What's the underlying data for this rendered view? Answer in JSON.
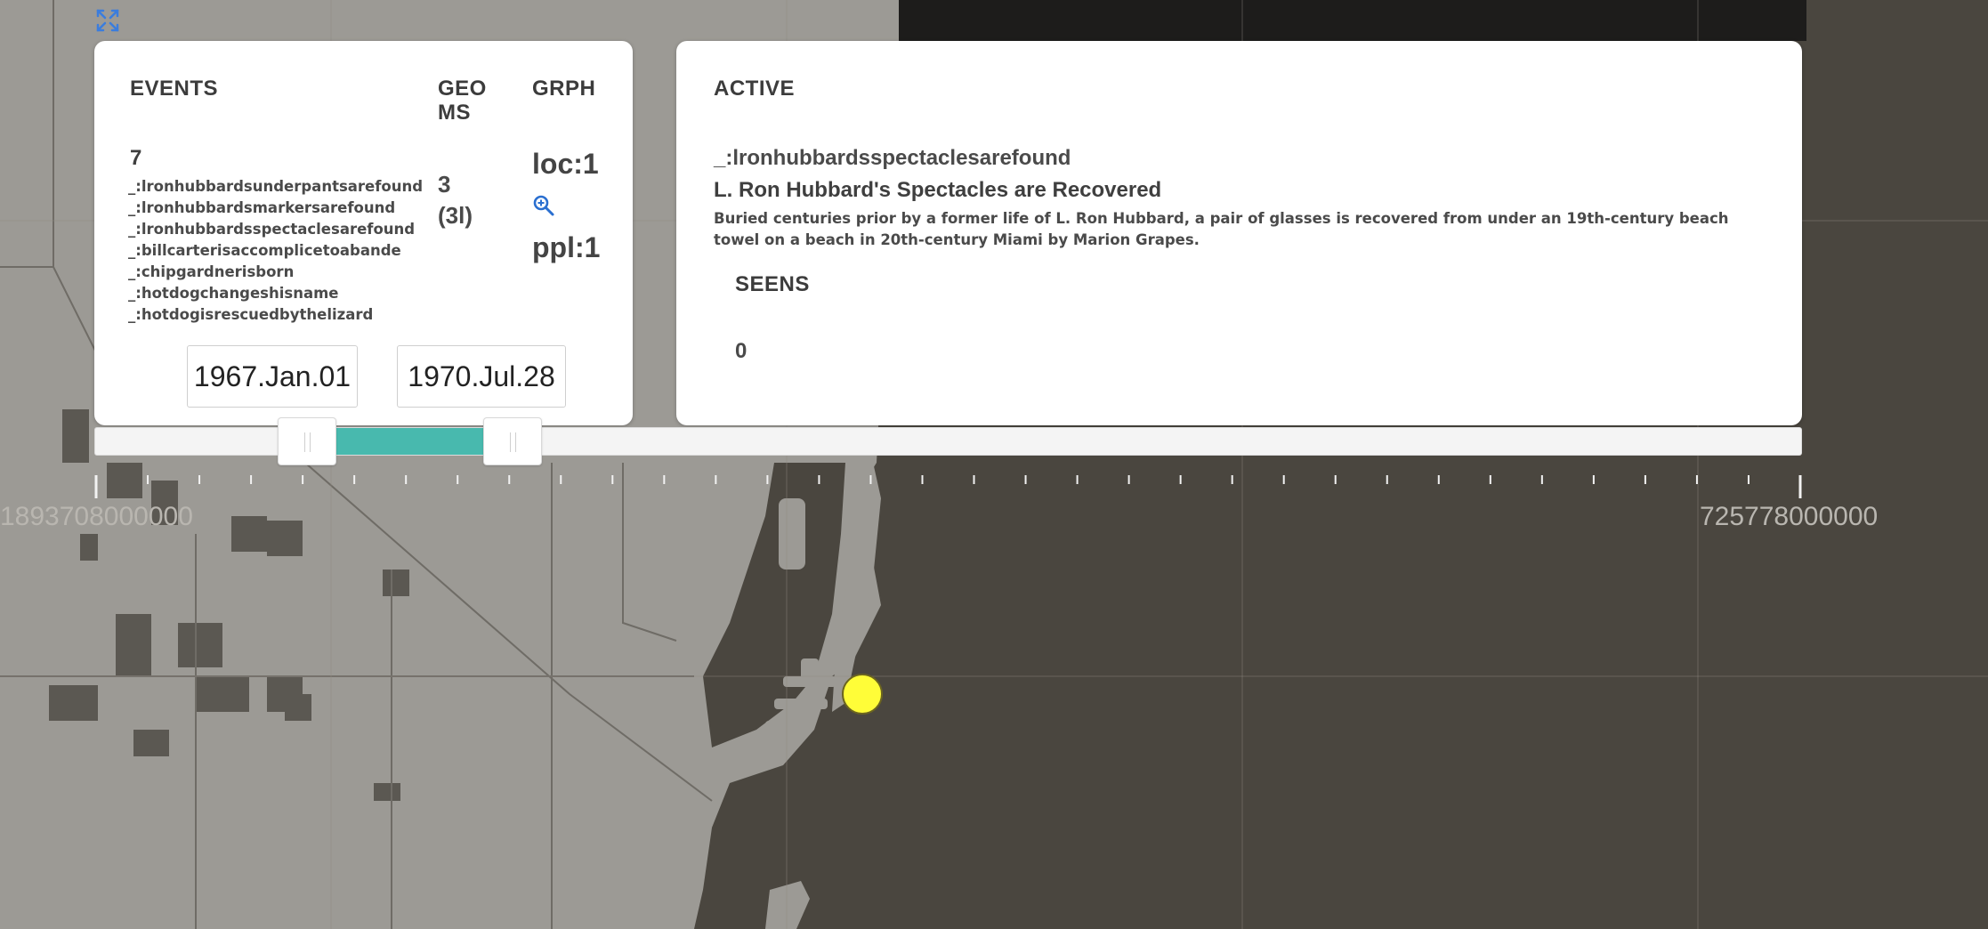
{
  "events_panel": {
    "title": "EVENTS",
    "count": "7",
    "items": [
      "_:lronhubbardsunderpantsarefound",
      "_:lronhubbardsmarkersarefound",
      "_:lronhubbardsspectaclesarefound",
      "_:billcarterisaccomplicetoabande",
      "_:chipgardnerisborn",
      "_:hotdogchangeshisname",
      "_:hotdogisrescuedbythelizard"
    ],
    "geoms_title": "GEO MS",
    "geoms_count": "3",
    "geoms_sub": "(3l)",
    "grph_title": "GRPH",
    "grph_loc": "loc:1",
    "grph_ppl": "ppl:1",
    "zoom_icon": "zoom-in-icon",
    "start_date": "1967.Jan.01",
    "end_date": "1970.Jul.28"
  },
  "active_panel": {
    "title": "ACTIVE",
    "event_id": "_:lronhubbardsspectaclesarefound",
    "event_name": "L. Ron Hubbard's Spectacles are Recovered",
    "description": "Buried centuries prior by a former life of L. Ron Hubbard, a pair of glasses is recovered from under an 19th-century beach towel on a beach in 20th-century Miami by Marion Grapes.",
    "seens_title": "SEENS",
    "seens_count": "0"
  },
  "timeline": {
    "min_label": "1893708000000",
    "max_label": "725778000000",
    "selected_start_fraction": 0.107,
    "selected_end_fraction": 0.227
  },
  "map": {
    "expand_icon": "expand-icon",
    "marker_color": "#fffd38"
  },
  "colors": {
    "accent": "#48b9ae",
    "link_icon": "#2a6fd0"
  }
}
